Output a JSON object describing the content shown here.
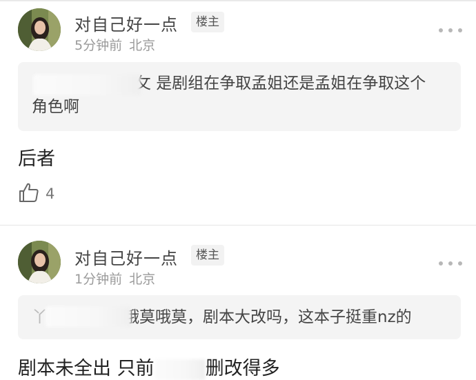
{
  "comments": [
    {
      "username": "对自己好一点",
      "badge": "楼主",
      "time": "5分钟前",
      "location": "北京",
      "quote_line1": "攵 是剧组在争取孟姐还是孟姐在争取这个",
      "quote_line2": "角色啊",
      "reply": "后者",
      "like_count": "4"
    },
    {
      "username": "对自己好一点",
      "badge": "楼主",
      "time": "1分钟前",
      "location": "北京",
      "quote_prefix": "丫",
      "quote_text": "哦莫哦莫，剧本大改吗，这本子挺重nz的",
      "reply_start": "剧本未全出 只前",
      "reply_end": "删改得多"
    }
  ],
  "icons": {
    "more": "more-dots-icon",
    "like": "thumbs-up-icon"
  },
  "colors": {
    "quote_bg": "#f4f4f4",
    "badge_bg": "#f2f2f2",
    "meta_text": "#9a9a9a"
  }
}
